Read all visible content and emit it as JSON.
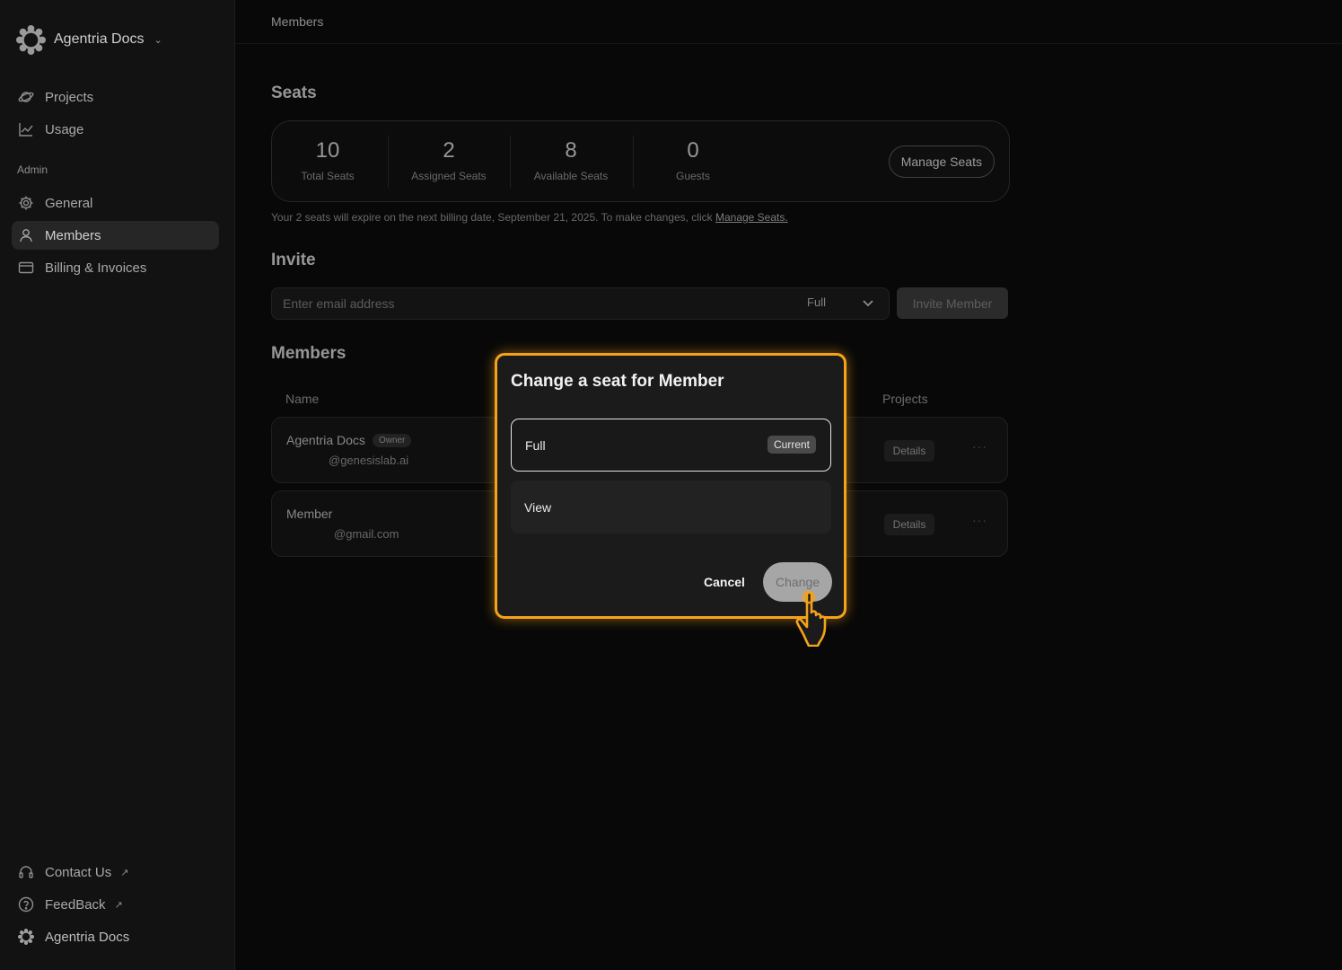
{
  "sidebar": {
    "workspace_name": "Agentria Docs",
    "nav": [
      {
        "label": "Projects",
        "icon": "planet-icon"
      },
      {
        "label": "Usage",
        "icon": "chart-line-icon"
      }
    ],
    "admin_label": "Admin",
    "admin_nav": [
      {
        "label": "General",
        "icon": "gear-icon"
      },
      {
        "label": "Members",
        "icon": "user-icon",
        "active": true
      },
      {
        "label": "Billing & Invoices",
        "icon": "card-icon"
      }
    ],
    "footer": [
      {
        "label": "Contact Us",
        "icon": "headset-icon"
      },
      {
        "label": "FeedBack",
        "icon": "help-circle-icon"
      },
      {
        "label": "Agentria Docs",
        "icon": "workspace-gear-icon"
      }
    ]
  },
  "topbar": {
    "title": "Members"
  },
  "seats": {
    "heading": "Seats",
    "stats": [
      {
        "value": "10",
        "label": "Total Seats"
      },
      {
        "value": "2",
        "label": "Assigned Seats"
      },
      {
        "value": "8",
        "label": "Available Seats"
      },
      {
        "value": "0",
        "label": "Guests"
      }
    ],
    "manage_label": "Manage Seats",
    "note_text": "Your 2 seats will expire on the next billing date, September 21, 2025. To make changes, click ",
    "note_link": "Manage Seats."
  },
  "invite": {
    "heading": "Invite",
    "email_placeholder": "Enter email address",
    "role_value": "Full",
    "button_label": "Invite Member"
  },
  "members": {
    "heading": "Members",
    "col_name": "Name",
    "col_projects": "Projects",
    "rows": [
      {
        "name": "Agentria Docs",
        "badge": "Owner",
        "email": "@genesislab.ai",
        "details": "Details"
      },
      {
        "name": "Member",
        "email": "@gmail.com",
        "details": "Details"
      }
    ]
  },
  "modal": {
    "title": "Change a seat for Member",
    "options": [
      {
        "label": "Full",
        "badge": "Current",
        "selected": true
      },
      {
        "label": "View",
        "selected": false
      }
    ],
    "cancel_label": "Cancel",
    "change_label": "Change",
    "accent_color": "#f5a21b"
  }
}
